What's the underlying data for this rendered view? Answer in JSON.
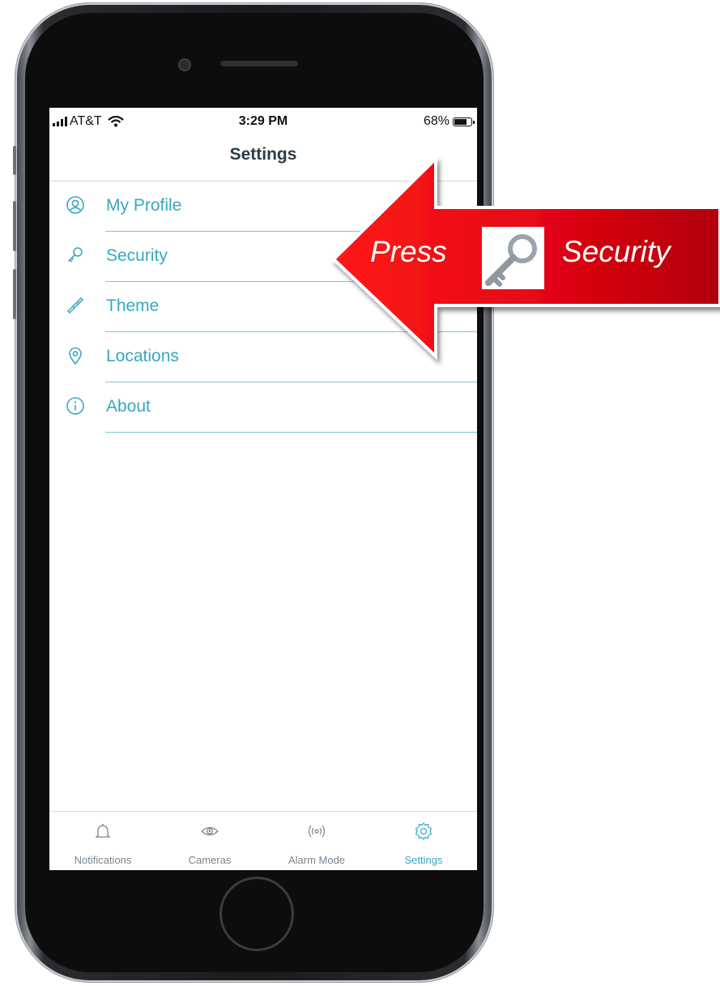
{
  "status_bar": {
    "carrier": "AT&T",
    "time": "3:29 PM",
    "battery": "68%",
    "battery_level": 0.68
  },
  "header": {
    "title": "Settings"
  },
  "menu": {
    "items": [
      {
        "label": "My Profile",
        "icon": "user-circle-icon"
      },
      {
        "label": "Security",
        "icon": "key-icon"
      },
      {
        "label": "Theme",
        "icon": "paintbrush-icon"
      },
      {
        "label": "Locations",
        "icon": "map-pin-icon"
      },
      {
        "label": "About",
        "icon": "info-icon"
      }
    ]
  },
  "tab_bar": {
    "tabs": [
      {
        "label": "Notifications",
        "icon": "bell-icon",
        "active": false
      },
      {
        "label": "Cameras",
        "icon": "eye-icon",
        "active": false
      },
      {
        "label": "Alarm Mode",
        "icon": "broadcast-icon",
        "active": false
      },
      {
        "label": "Settings",
        "icon": "gear-icon",
        "active": true
      }
    ]
  },
  "callout": {
    "press_text": "Press",
    "target_text": "Security",
    "icon": "key-icon"
  },
  "colors": {
    "accent": "#3aa7bf",
    "callout_red": "#e30613"
  }
}
